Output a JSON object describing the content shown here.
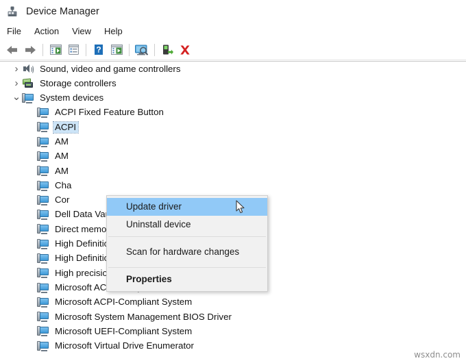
{
  "window": {
    "title": "Device Manager",
    "icon": "device-manager-icon"
  },
  "menubar": {
    "items": [
      {
        "label": "File"
      },
      {
        "label": "Action"
      },
      {
        "label": "View"
      },
      {
        "label": "Help"
      }
    ]
  },
  "toolbar": {
    "buttons": [
      {
        "name": "back-button",
        "icon": "left-arrow-icon"
      },
      {
        "name": "forward-button",
        "icon": "right-arrow-icon"
      },
      {
        "name": "separator-1",
        "icon": "separator"
      },
      {
        "name": "show-hide-console-tree-button",
        "icon": "console-tree-icon"
      },
      {
        "name": "properties-button",
        "icon": "properties-icon"
      },
      {
        "name": "separator-2",
        "icon": "separator"
      },
      {
        "name": "help-button",
        "icon": "help-question-icon"
      },
      {
        "name": "update-driver-button",
        "icon": "update-driver-icon"
      },
      {
        "name": "separator-3",
        "icon": "separator"
      },
      {
        "name": "scan-for-hardware-changes-button",
        "icon": "scan-hardware-icon"
      },
      {
        "name": "separator-4",
        "icon": "separator"
      },
      {
        "name": "disable-device-button",
        "icon": "disable-device-icon"
      },
      {
        "name": "uninstall-device-button",
        "icon": "red-x-icon"
      }
    ]
  },
  "tree": {
    "rows": [
      {
        "label": "Sound, video and game controllers",
        "indent": 1,
        "chevron": "collapsed",
        "icon": "speaker-icon",
        "selected": false
      },
      {
        "label": "Storage controllers",
        "indent": 1,
        "chevron": "collapsed",
        "icon": "storage-icon",
        "selected": false
      },
      {
        "label": "System devices",
        "indent": 1,
        "chevron": "expanded",
        "icon": "computer-icon",
        "selected": false
      },
      {
        "label": "ACPI Fixed Feature Button",
        "indent": 2,
        "chevron": "none",
        "icon": "computer-icon",
        "selected": false
      },
      {
        "label": "ACPI",
        "indent": 2,
        "chevron": "none",
        "icon": "computer-icon",
        "selected": true
      },
      {
        "label": "AM",
        "indent": 2,
        "chevron": "none",
        "icon": "computer-icon",
        "selected": false
      },
      {
        "label": "AM",
        "indent": 2,
        "chevron": "none",
        "icon": "computer-icon",
        "selected": false
      },
      {
        "label": "AM",
        "indent": 2,
        "chevron": "none",
        "icon": "computer-icon",
        "selected": false
      },
      {
        "label": "Cha",
        "indent": 2,
        "chevron": "none",
        "icon": "computer-icon",
        "selected": false
      },
      {
        "label": "Cor",
        "indent": 2,
        "chevron": "none",
        "icon": "computer-icon",
        "selected": false
      },
      {
        "label": "Dell Data Vault Control Device",
        "indent": 2,
        "chevron": "none",
        "icon": "computer-icon",
        "selected": false
      },
      {
        "label": "Direct memory access controller",
        "indent": 2,
        "chevron": "none",
        "icon": "computer-icon",
        "selected": false
      },
      {
        "label": "High Definition Audio Controller",
        "indent": 2,
        "chevron": "none",
        "icon": "computer-icon",
        "selected": false
      },
      {
        "label": "High Definition Audio Controller",
        "indent": 2,
        "chevron": "none",
        "icon": "computer-icon",
        "selected": false
      },
      {
        "label": "High precision event timer",
        "indent": 2,
        "chevron": "none",
        "icon": "computer-icon",
        "selected": false
      },
      {
        "label": "Microsoft ACPI-Compliant Embedded Controller",
        "indent": 2,
        "chevron": "none",
        "icon": "computer-icon",
        "selected": false
      },
      {
        "label": "Microsoft ACPI-Compliant System",
        "indent": 2,
        "chevron": "none",
        "icon": "computer-icon",
        "selected": false
      },
      {
        "label": "Microsoft System Management BIOS Driver",
        "indent": 2,
        "chevron": "none",
        "icon": "computer-icon",
        "selected": false
      },
      {
        "label": "Microsoft UEFI-Compliant System",
        "indent": 2,
        "chevron": "none",
        "icon": "computer-icon",
        "selected": false
      },
      {
        "label": "Microsoft Virtual Drive Enumerator",
        "indent": 2,
        "chevron": "none",
        "icon": "computer-icon",
        "selected": false
      }
    ]
  },
  "context_menu": {
    "items": [
      {
        "label": "Update driver",
        "highlighted": true,
        "bold": false,
        "separator_after": false
      },
      {
        "label": "Uninstall device",
        "highlighted": false,
        "bold": false,
        "separator_after": true
      },
      {
        "label": "Scan for hardware changes",
        "highlighted": false,
        "bold": false,
        "separator_after": true
      },
      {
        "label": "Properties",
        "highlighted": false,
        "bold": true,
        "separator_after": false
      }
    ]
  },
  "cursor": {
    "icon": "mouse-pointer-icon"
  },
  "watermark": {
    "text": "wsxdn.com"
  },
  "colors": {
    "menu_highlight": "#91c9f7",
    "tree_selection": "#cce4f7",
    "menu_background": "#f1f1f1",
    "red_x": "#d42222"
  }
}
